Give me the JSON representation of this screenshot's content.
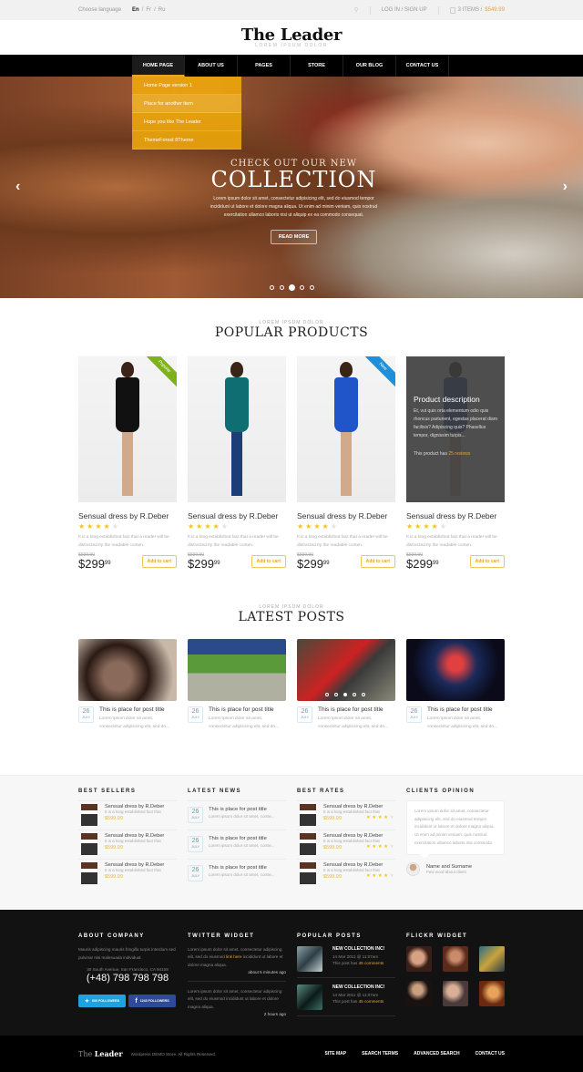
{
  "topbar": {
    "choose_language": "Choose language",
    "languages": [
      "En",
      "Fr",
      "Ru"
    ],
    "login": "LOG IN / SIGN UP",
    "cart_items": "3 ITEMS /",
    "cart_total": "$549.99",
    "icons": [
      "search-icon",
      "cart-icon"
    ]
  },
  "header": {
    "logo": "The Leader",
    "tagline": "LOREM IPSUM DOLOR"
  },
  "nav": {
    "items": [
      "HOME PAGE",
      "ABOUT US",
      "PAGES",
      "STORE",
      "OUR BLOG",
      "CONTACT US"
    ],
    "active": "HOME PAGE",
    "dropdown": [
      "Home Page version 1",
      "Place for another item",
      "Hope you like The Leader",
      "ThemeForest 8Theme"
    ]
  },
  "hero": {
    "kicker": "CHECK OUT OUR NEW",
    "title": "COLLECTION",
    "description": "Lorem ipsum dolor sit amet, consectetur adipisicing elit, sed do eiusmod tempor incididunt ut labore et dolore magna aliqua. Ut enim ad minim veniam, quis nostrud exercitation ullamco laboris nisi ut aliquip ex ea commodo consequat.",
    "button": "READ MORE",
    "prev_icon": "‹",
    "next_icon": "›",
    "slides": 5,
    "active_slide": 3
  },
  "products": {
    "kicker": "LOREM IPSUM DOLOR",
    "title": "POPULAR PRODUCTS",
    "items": [
      {
        "name": "Sensual dress by R.Deber",
        "rating": 4,
        "description": "It is a long established fact that a reader will be distracted by the readable conten.",
        "old_price": "$599.99",
        "price": "$299",
        "cents": "99",
        "cart": "Add to cart",
        "badge": "Popular",
        "dress": "#111111"
      },
      {
        "name": "Sensual dress by R.Deber",
        "rating": 4,
        "description": "It is a long established fact that a reader will be distracted by the readable conten.",
        "old_price": "$599.99",
        "price": "$299",
        "cents": "99",
        "cart": "Add to cart",
        "badge": "",
        "dress": "#0f6e72"
      },
      {
        "name": "Sensual dress by R.Deber",
        "rating": 4,
        "description": "It is a long established fact that a reader will be distracted by the readable conten.",
        "old_price": "$599.99",
        "price": "$299",
        "cents": "99",
        "cart": "Add to cart",
        "badge": "New",
        "dress": "#1f55c8"
      },
      {
        "name": "Sensual dress by R.Deber",
        "rating": 4,
        "description": "It is a long established fact that a reader will be distracted by the readable conten.",
        "old_price": "$599.99",
        "price": "$299",
        "cents": "99",
        "cart": "Add to cart",
        "badge": "",
        "dress": "#1b4a9a"
      }
    ],
    "hover": {
      "title": "Product description",
      "text": "Et, vut quis orta elementum odio quis rhoncus parturient, egestas placerat diam facilisis? Adipiscing quis? Phasellus tempor, dignissim turpis...",
      "reviews_prefix": "This product has",
      "reviews": "25 reviews"
    }
  },
  "posts": {
    "kicker": "LOREM IPSUM DOLOR",
    "title": "LATEST POSTS",
    "items": [
      {
        "day": "26",
        "month": "JULY",
        "title": "This is place for post title",
        "excerpt": "Lorem ipsum dolor sit amet, consectetur adipisicing elit, sed do..."
      },
      {
        "day": "26",
        "month": "JULY",
        "title": "This is place for post title",
        "excerpt": "Lorem ipsum dolor sit amet, consectetur adipisicing elit, sed do..."
      },
      {
        "day": "26",
        "month": "JULY",
        "title": "This is place for post title",
        "excerpt": "Lorem ipsum dolor sit amet, consectetur adipisicing elit, sed do..."
      },
      {
        "day": "26",
        "month": "JULY",
        "title": "This is place for post title",
        "excerpt": "Lorem ipsum dolor sit amet, consectetur adipisicing elit, sed do..."
      }
    ]
  },
  "widgets": {
    "best_sellers": {
      "title": "BEST SELLERS",
      "items": [
        {
          "name": "Sensual dress by R.Deber",
          "desc": "It is a long established fact that",
          "price": "$599.99"
        },
        {
          "name": "Sensual dress by R.Deber",
          "desc": "It is a long established fact that",
          "price": "$599.99"
        },
        {
          "name": "Sensual dress by R.Deber",
          "desc": "It is a long established fact that",
          "price": "$599.99"
        }
      ]
    },
    "latest_news": {
      "title": "LATEST NEWS",
      "items": [
        {
          "day": "26",
          "month": "JULY",
          "title": "This is place for post title",
          "excerpt": "Lorem ipsum dolor sit amet, conse..."
        },
        {
          "day": "26",
          "month": "JULY",
          "title": "This is place for post title",
          "excerpt": "Lorem ipsum dolor sit amet, conse..."
        },
        {
          "day": "26",
          "month": "JULY",
          "title": "This is place for post title",
          "excerpt": "Lorem ipsum dolor sit amet, conse..."
        }
      ]
    },
    "best_rates": {
      "title": "BEST RATES",
      "items": [
        {
          "name": "Sensual dress by R.Deber",
          "desc": "It is a long established fact that",
          "price": "$599.99",
          "rating": 4
        },
        {
          "name": "Sensual dress by R.Deber",
          "desc": "It is a long established fact that",
          "price": "$599.99",
          "rating": 4
        },
        {
          "name": "Sensual dress by R.Deber",
          "desc": "It is a long established fact that",
          "price": "$599.99",
          "rating": 4
        }
      ]
    },
    "clients": {
      "title": "CLIENTS OPINION",
      "quote": "Lorem ipsum dolor sit amet, consectetur adipisicing elit, sed do eiusmod tempor incididunt ut labore et dolore magna aliqua. Ut enim ad minim veniam, quis nostrud exercitation ullamco laboris nisi commodo.",
      "name": "Name and Surname",
      "subtitle": "Few word about client"
    }
  },
  "footer": {
    "about": {
      "title": "ABOUT COMPANY",
      "text": "Mauris adipiscing mauris fringilla turpis interdum sed pulvinar nisi malesuada individual.",
      "address": "30 South Avenue, San Francisco, CA 94108",
      "phone": "(+48) 798 798 798",
      "twitter": "600 FOLLOWERS",
      "facebook": "1243 FOLLOWERS"
    },
    "twitter": {
      "title": "TWITTER WIDGET",
      "tweets": [
        {
          "before": "Lorem ipsum dolor sit amet, consectetur adipiscing elit, sed do eiusmod ",
          "link": "link here",
          "after": " incididunt ut labore et dolore magna aliqua.",
          "time": "about 5 minutes ago"
        },
        {
          "before": "Lorem ipsum dolor sit amet, consectetur adipiscing elit, sed do eiusmod incididunt ut labore et dolore magna aliqua.",
          "link": "",
          "after": "",
          "time": "2 hours ago"
        }
      ]
    },
    "popular": {
      "title": "POPULAR POSTS",
      "items": [
        {
          "title": "NEW COLLECTION INC!",
          "date": "14 Mar 2011 @ 11:07am",
          "prefix": "This post has",
          "comments": "45 comments"
        },
        {
          "title": "NEW COLLECTION INC!",
          "date": "14 Mar 2011 @ 11:07am",
          "prefix": "This post has",
          "comments": "45 comments"
        }
      ]
    },
    "flickr": {
      "title": "FLICKR WIDGET"
    }
  },
  "bottombar": {
    "logo_light": "The",
    "logo_bold": "Leader",
    "copyright": "Wordpress DEMO Store. All Rights Reserved.",
    "links": [
      "SITE MAP",
      "SEARCH TERMS",
      "ADVANCED SEARCH",
      "CONTACT US"
    ]
  },
  "colors": {
    "accent": "#e8a824",
    "popular_ribbon": "#7fb11c",
    "new_ribbon": "#1e8fd8",
    "date_blue": "#5aa0d0"
  }
}
